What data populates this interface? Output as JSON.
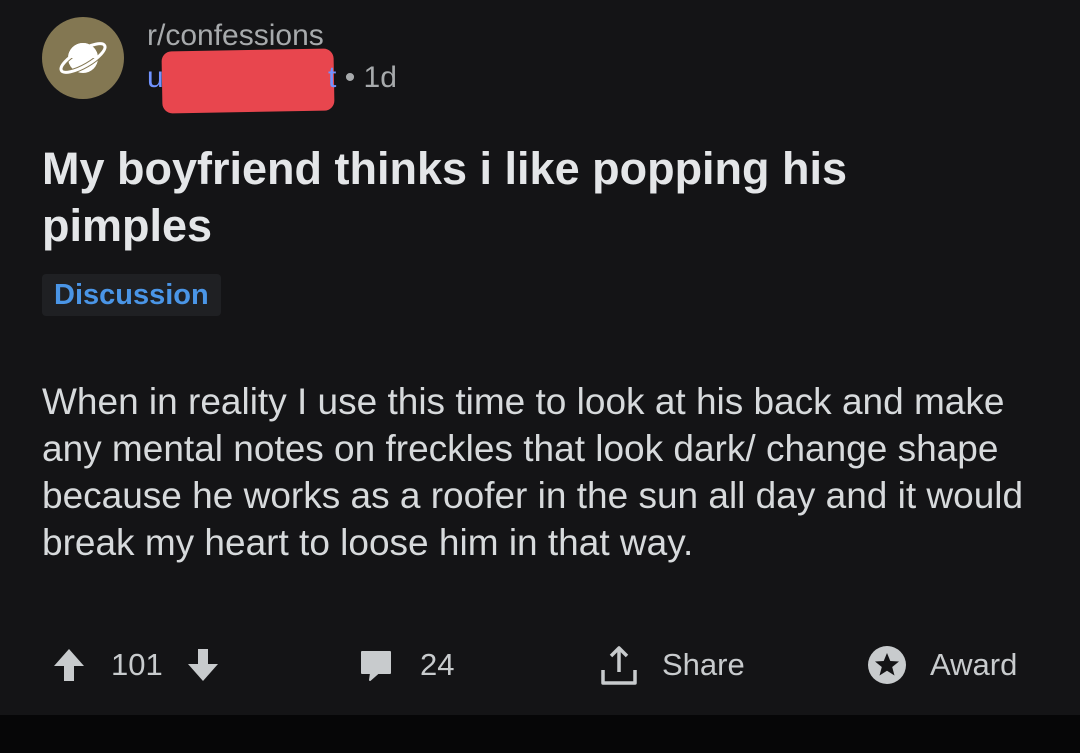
{
  "post": {
    "subreddit": "r/confessions",
    "author_visible": "u",
    "author_tail": "t",
    "separator": "•",
    "age": "1d",
    "title": "My boyfriend thinks i like popping his pimples",
    "flair": "Discussion",
    "body": "When in reality I use this time to look at his back and make any mental notes on freckles that look dark/ change shape because he works as a roofer in the sun all day and it would break my heart to loose him in that way."
  },
  "actions": {
    "votes": "101",
    "comments": "24",
    "share_label": "Share",
    "award_label": "Award"
  },
  "icons": {
    "subreddit_avatar": "planet-icon",
    "upvote": "arrow-up-icon",
    "downvote": "arrow-down-icon",
    "comment": "comment-bubble-icon",
    "share": "share-upload-icon",
    "award": "award-star-icon"
  },
  "colors": {
    "background": "#141416",
    "avatar": "#837752",
    "username": "#7193ff",
    "flair_text": "#4a95e6",
    "redaction": "#e8464e"
  }
}
